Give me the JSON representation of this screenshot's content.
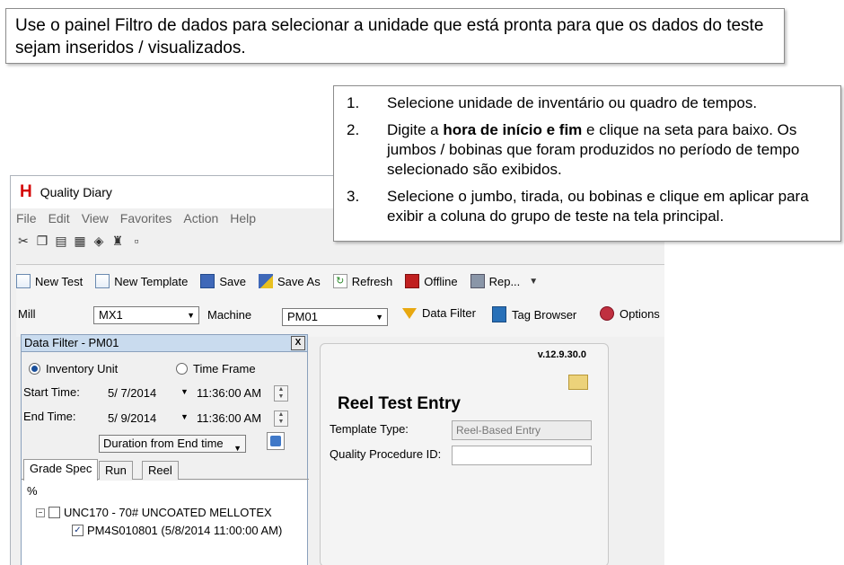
{
  "instructions": {
    "top": "Use o painel Filtro de dados para selecionar a unidade que está pronta para que os dados do teste sejam inseridos / visualizados.",
    "steps": [
      {
        "num": "1.",
        "text": "Selecione unidade de inventário ou quadro de tempos."
      },
      {
        "num": "2.",
        "pre": "Digite a ",
        "bold": "hora de início e fim",
        "post": " e clique na seta para baixo. Os jumbos / bobinas que foram produzidos no período de tempo selecionado são exibidos."
      },
      {
        "num": "3.",
        "text": "Selecione o jumbo, tirada, ou bobinas e clique em aplicar para exibir a coluna do grupo de teste na tela principal."
      }
    ]
  },
  "window": {
    "logo": "H",
    "title": "Quality Diary"
  },
  "menu": [
    "File",
    "Edit",
    "View",
    "Favorites",
    "Action",
    "Help"
  ],
  "iconbar": [
    "scissors-icon",
    "copy-icon",
    "paste-icon",
    "print-icon",
    "tag-icon",
    "people-icon",
    "doc-icon"
  ],
  "toolbar": {
    "new_test": "New Test",
    "new_template": "New Template",
    "save": "Save",
    "save_as": "Save As",
    "refresh": "Refresh",
    "offline": "Offline",
    "report": "Rep..."
  },
  "selectors": {
    "mill_label": "Mill",
    "mill_value": "MX1",
    "machine_label": "Machine",
    "machine_value": "PM01",
    "data_filter": "Data Filter",
    "tag_browser": "Tag Browser",
    "options": "Options"
  },
  "filter": {
    "header": "Data Filter - PM01",
    "close": "X",
    "radio_inventory": "Inventory Unit",
    "radio_timeframe": "Time Frame",
    "start_label": "Start Time:",
    "start_date": "5/ 7/2014",
    "start_time": "11:36:00 AM",
    "end_label": "End Time:",
    "end_date": "5/ 9/2014",
    "end_time": "11:36:00 AM",
    "duration": "Duration from End time",
    "tabs": [
      "Grade Spec",
      "Run",
      "Reel"
    ],
    "tree_header": "%",
    "tree_parent": "UNC170 - 70# UNCOATED MELLOTEX",
    "tree_child": "PM4S010801 (5/8/2014 11:00:00 AM)"
  },
  "reel": {
    "version": "v.12.9.30.0",
    "title": "Reel Test Entry",
    "template_label": "Template Type:",
    "template_value": "Reel-Based Entry",
    "qp_label": "Quality Procedure ID:"
  }
}
